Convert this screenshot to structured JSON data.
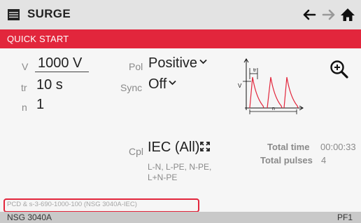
{
  "titlebar": {
    "title": "SURGE",
    "icons": [
      "menu-icon",
      "back-arrow-icon",
      "forward-arrow-icon",
      "home-icon"
    ]
  },
  "banner": {
    "label": "QUICK START"
  },
  "params": {
    "v_label": "V",
    "v_value": "1000 V",
    "tr_label": "tr",
    "tr_value": "10 s",
    "n_label": "n",
    "n_value": "1",
    "pol_label": "Pol",
    "pol_value": "Positive",
    "sync_label": "Sync",
    "sync_value": "Off",
    "cpl_label": "Cpl",
    "cpl_value": "IEC (All)",
    "cpl_detail": "L-N, L-PE, N-PE, L+N-PE"
  },
  "diagram": {
    "v_label": "V",
    "tr_label": "tr",
    "n_label": "n"
  },
  "totals": {
    "time_label": "Total time",
    "time_value": "00:00:33",
    "pulses_label": "Total pulses",
    "pulses_value": "4"
  },
  "code_line": "PCD & s-3-690-1000-100 (NSG 3040A-IEC)",
  "footer": {
    "model": "NSG 3040A",
    "pf": "PF1"
  },
  "colors": {
    "accent": "#e2263c",
    "titlebar": "#e3e3e3",
    "footer": "#c9c9c9"
  }
}
